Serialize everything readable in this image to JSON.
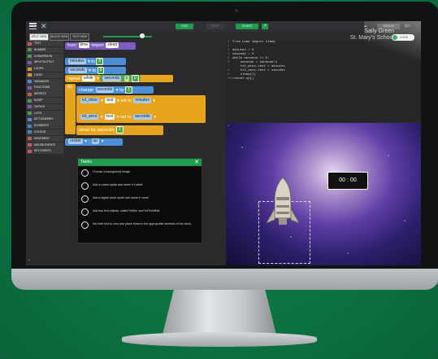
{
  "header": {
    "run_label": "RUN",
    "stop_label": "STOP",
    "share_label": "SHARE",
    "sign_in_label": "SIGN IN",
    "user_name": "Sally Green",
    "school_name": "St. Mary's School",
    "toggle_label": "CODE"
  },
  "views": [
    {
      "label": "SPLIT VIEW"
    },
    {
      "label": "BLOCK VIEW"
    },
    {
      "label": "TEXT VIEW"
    }
  ],
  "categories": [
    {
      "label": "TEXT",
      "color": "#c65a5a"
    },
    {
      "label": "NUMBER",
      "color": "#4a9b4d"
    },
    {
      "label": "CONVERSION",
      "color": "#4a9b4d"
    },
    {
      "label": "INPUT/OUTPUT",
      "color": "#7a5ea8"
    },
    {
      "label": "LOOPS",
      "color": "#d49a22"
    },
    {
      "label": "LOGIC",
      "color": "#d49a22"
    },
    {
      "label": "VARIABLES",
      "color": "#4c8fd6"
    },
    {
      "label": "FUNCTIONS",
      "color": "#7a5ea8"
    },
    {
      "label": "IMPORTS",
      "color": "#c65a5a"
    },
    {
      "label": "SLEEP",
      "color": "#4a9b4d"
    },
    {
      "label": "TUPLES",
      "color": "#7a5ea8"
    },
    {
      "label": "LISTS",
      "color": "#4a9b4d"
    },
    {
      "label": "DICTIONARIES",
      "color": "#4c8fd6"
    },
    {
      "label": "ELEMENTS",
      "color": "#3a8ac0"
    },
    {
      "label": "COLOUR",
      "color": "#3a8ac0"
    },
    {
      "label": "MOVEMENT",
      "color": "#c65a5a"
    },
    {
      "label": "MOUSE EVENTS",
      "color": "#c65a5a"
    },
    {
      "label": "KEY EVENTS",
      "color": "#c65a5a"
    }
  ],
  "blocks": {
    "import_from": "from",
    "import_module": "time",
    "import_kw": "import",
    "import_name": "sleep",
    "set_minutes_var": "minutes",
    "set_minutes_val": "0",
    "set_seconds_var": "seconds",
    "set_seconds_val": "0",
    "repeat_kw": "repeat",
    "while_kw": "while",
    "cond_var": "seconds",
    "cond_op": "≥",
    "cond_val": "0",
    "do_kw": "do",
    "change_kw": "change",
    "change_var": "seconds",
    "by_kw": "by",
    "change_val": "1",
    "txt_mins": "txt_mins",
    "txt_secs": "txt_secs",
    "text_kw": "text",
    "set_to": "set to",
    "minutes_ref": "minutes",
    "seconds_ref": "seconds",
    "sleep_label": "sleep for seconds:",
    "sleep_val": "1",
    "rocket_var": "rocket",
    "up_label": "up"
  },
  "code_lines": [
    "from time import sleep",
    "",
    "minutes = 0",
    "seconds = 0",
    "while seconds >= 0:",
    "    seconds = seconds+1",
    "    txt_mins.text = minutes",
    "    txt_secs.text = seconds",
    "    sleep(1)",
    "rocket.up()"
  ],
  "stage": {
    "minutes_display": "00",
    "separator": ":",
    "seconds_display": "00"
  },
  "tasks": {
    "title": "Tasks",
    "items": [
      "Choose a background image.",
      "Add a rocket sprite and name it 'rocket'",
      "Add a digital clock sprite and name it 'clock'",
      "Add two text objects, called 'txtMin' and 'txtTenthMin'",
      "Set their text to zero and place these in the appropriate sections of the clock."
    ]
  }
}
